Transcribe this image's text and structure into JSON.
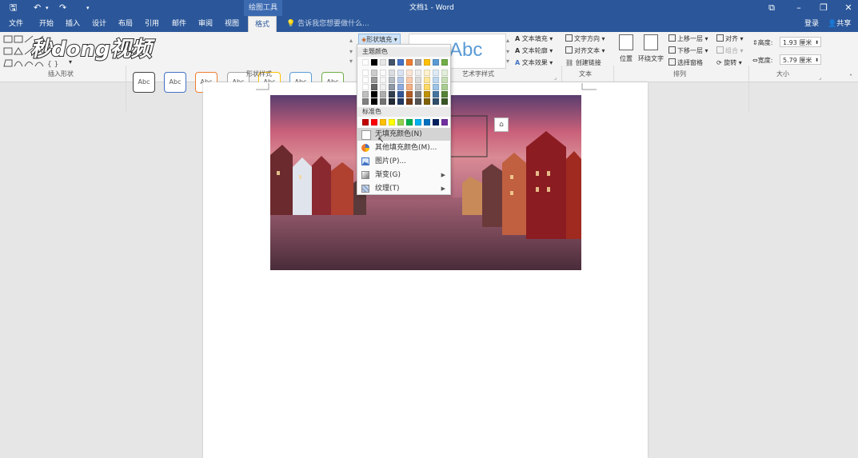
{
  "titlebar": {
    "drawing_tools": "绘图工具",
    "doc_title": "文档1 - Word"
  },
  "tabs": [
    "文件",
    "开始",
    "插入",
    "设计",
    "布局",
    "引用",
    "邮件",
    "审阅",
    "视图",
    "格式"
  ],
  "active_tab": "格式",
  "tell_me_placeholder": "告诉我您想要做什么...",
  "account": {
    "login": "登录",
    "share": "共享"
  },
  "watermark": "秒dong视频",
  "ribbon": {
    "groups": {
      "insert_shapes": "插入形状",
      "shape_styles": "形状样式",
      "wordart_styles": "艺术字样式",
      "text": "文本",
      "arrange": "排列",
      "size": "大小"
    },
    "style_sample": "Abc",
    "shape_fill": "形状填充",
    "text_fill": "文本填充",
    "text_outline": "文本轮廓",
    "text_effects": "文本效果",
    "text_direction": "文字方向",
    "align_text": "对齐文本",
    "create_link": "创建链接",
    "position": "位置",
    "wrap_text": "环绕文字",
    "bring_forward": "上移一层",
    "send_backward": "下移一层",
    "selection_pane": "选择窗格",
    "align": "对齐",
    "group": "组合",
    "rotate": "旋转",
    "height_label": "高度:",
    "height_value": "1.93 厘米",
    "width_label": "宽度:",
    "width_value": "5.79 厘米"
  },
  "fill_menu": {
    "theme_colors_header": "主题颜色",
    "standard_colors_header": "标准色",
    "no_fill": "无填充颜色(N)",
    "more_fill_colors": "其他填充颜色(M)...",
    "picture": "图片(P)...",
    "gradient": "渐变(G)",
    "texture": "纹理(T)",
    "theme_colors": [
      "#ffffff",
      "#000000",
      "#e7e6e6",
      "#44546a",
      "#4472c4",
      "#ed7d31",
      "#a5a5a5",
      "#ffc000",
      "#5b9bd5",
      "#70ad47"
    ],
    "standard_colors": [
      "#c00000",
      "#ff0000",
      "#ffc000",
      "#ffff00",
      "#92d050",
      "#00b050",
      "#00b0f0",
      "#0070c0",
      "#002060",
      "#7030a0"
    ]
  },
  "colors": {
    "word_blue": "#2b579a",
    "ribbon_bg": "#f3f3f3"
  }
}
